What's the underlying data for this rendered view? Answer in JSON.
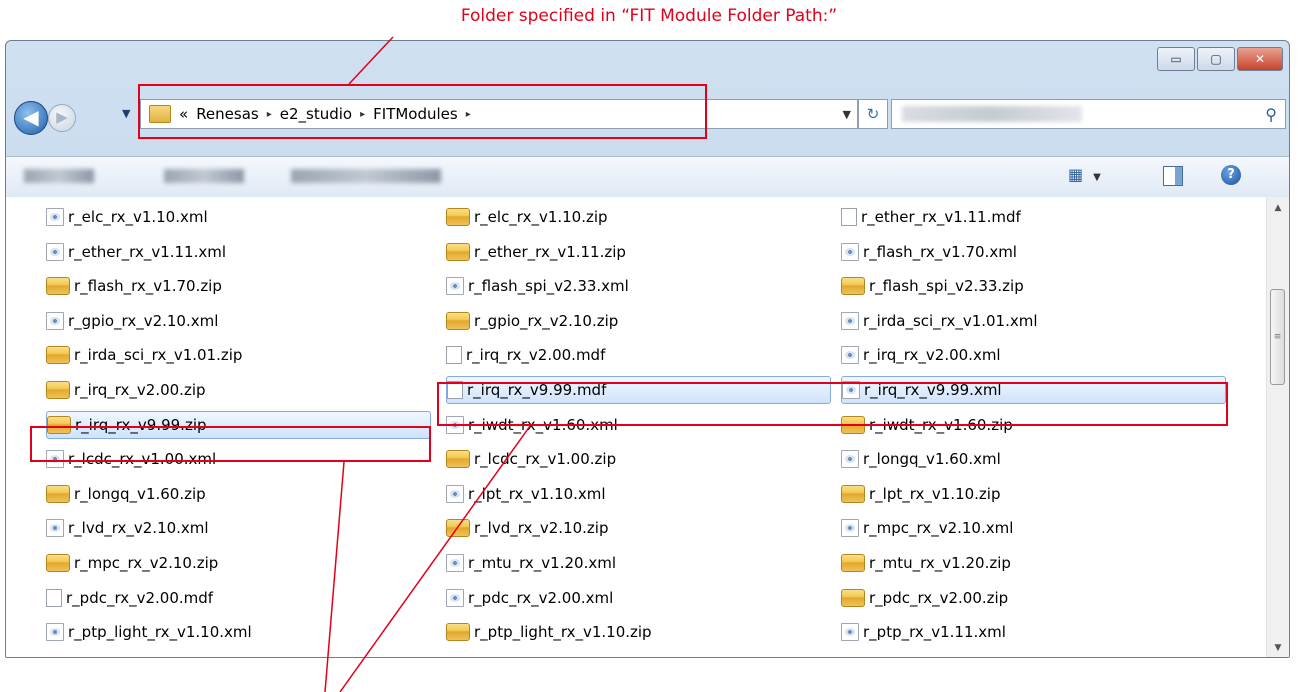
{
  "callout": {
    "text": "Folder specified in “FIT Module Folder Path:”"
  },
  "window": {
    "controls": {
      "minimize": "▭",
      "maximize": "▢",
      "close": "✕"
    },
    "nav": {
      "back": "◀",
      "forward": "▶",
      "recent": "▼"
    },
    "address": {
      "prefix": "«",
      "crumbs": [
        "Renesas",
        "e2_studio",
        "FITModules"
      ],
      "separator": "▸",
      "dropdown": "▼"
    },
    "refresh": "↻",
    "search_icon": "⚲",
    "toolbar": {
      "views_icon": "▦",
      "views_arrow": "▼",
      "help": "?"
    },
    "files": [
      [
        "r_elc_rx_v1.10.xml",
        "xml"
      ],
      [
        "r_elc_rx_v1.10.zip",
        "zip"
      ],
      [
        "r_ether_rx_v1.11.mdf",
        "mdf"
      ],
      [
        "r_ether_rx_v1.11.xml",
        "xml"
      ],
      [
        "r_ether_rx_v1.11.zip",
        "zip"
      ],
      [
        "r_flash_rx_v1.70.xml",
        "xml"
      ],
      [
        "r_flash_rx_v1.70.zip",
        "zip"
      ],
      [
        "r_flash_spi_v2.33.xml",
        "xml"
      ],
      [
        "r_flash_spi_v2.33.zip",
        "zip"
      ],
      [
        "r_gpio_rx_v2.10.xml",
        "xml"
      ],
      [
        "r_gpio_rx_v2.10.zip",
        "zip"
      ],
      [
        "r_irda_sci_rx_v1.01.xml",
        "xml"
      ],
      [
        "r_irda_sci_rx_v1.01.zip",
        "zip"
      ],
      [
        "r_irq_rx_v2.00.mdf",
        "mdf"
      ],
      [
        "r_irq_rx_v2.00.xml",
        "xml"
      ],
      [
        "r_irq_rx_v2.00.zip",
        "zip"
      ],
      [
        "r_irq_rx_v9.99.mdf",
        "mdf"
      ],
      [
        "r_irq_rx_v9.99.xml",
        "xml"
      ],
      [
        "r_irq_rx_v9.99.zip",
        "zip"
      ],
      [
        "r_iwdt_rx_v1.60.xml",
        "xml"
      ],
      [
        "r_iwdt_rx_v1.60.zip",
        "zip"
      ],
      [
        "r_lcdc_rx_v1.00.xml",
        "xml"
      ],
      [
        "r_lcdc_rx_v1.00.zip",
        "zip"
      ],
      [
        "r_longq_v1.60.xml",
        "xml"
      ],
      [
        "r_longq_v1.60.zip",
        "zip"
      ],
      [
        "r_lpt_rx_v1.10.xml",
        "xml"
      ],
      [
        "r_lpt_rx_v1.10.zip",
        "zip"
      ],
      [
        "r_lvd_rx_v2.10.xml",
        "xml"
      ],
      [
        "r_lvd_rx_v2.10.zip",
        "zip"
      ],
      [
        "r_mpc_rx_v2.10.xml",
        "xml"
      ],
      [
        "r_mpc_rx_v2.10.zip",
        "zip"
      ],
      [
        "r_mtu_rx_v1.20.xml",
        "xml"
      ],
      [
        "r_mtu_rx_v1.20.zip",
        "zip"
      ],
      [
        "r_pdc_rx_v2.00.mdf",
        "mdf"
      ],
      [
        "r_pdc_rx_v2.00.xml",
        "xml"
      ],
      [
        "r_pdc_rx_v2.00.zip",
        "zip"
      ],
      [
        "r_ptp_light_rx_v1.10.xml",
        "xml"
      ],
      [
        "r_ptp_light_rx_v1.10.zip",
        "zip"
      ],
      [
        "r_ptp_rx_v1.11.xml",
        "xml"
      ]
    ],
    "highlighted": [
      "r_irq_rx_v9.99.zip",
      "r_irq_rx_v9.99.mdf",
      "r_irq_rx_v9.99.xml"
    ],
    "scrollbar": {
      "up": "▲",
      "down": "▼",
      "grip": "≡"
    }
  },
  "colors": {
    "annotation": "#e2001a",
    "selection": "#cfe3fb"
  }
}
